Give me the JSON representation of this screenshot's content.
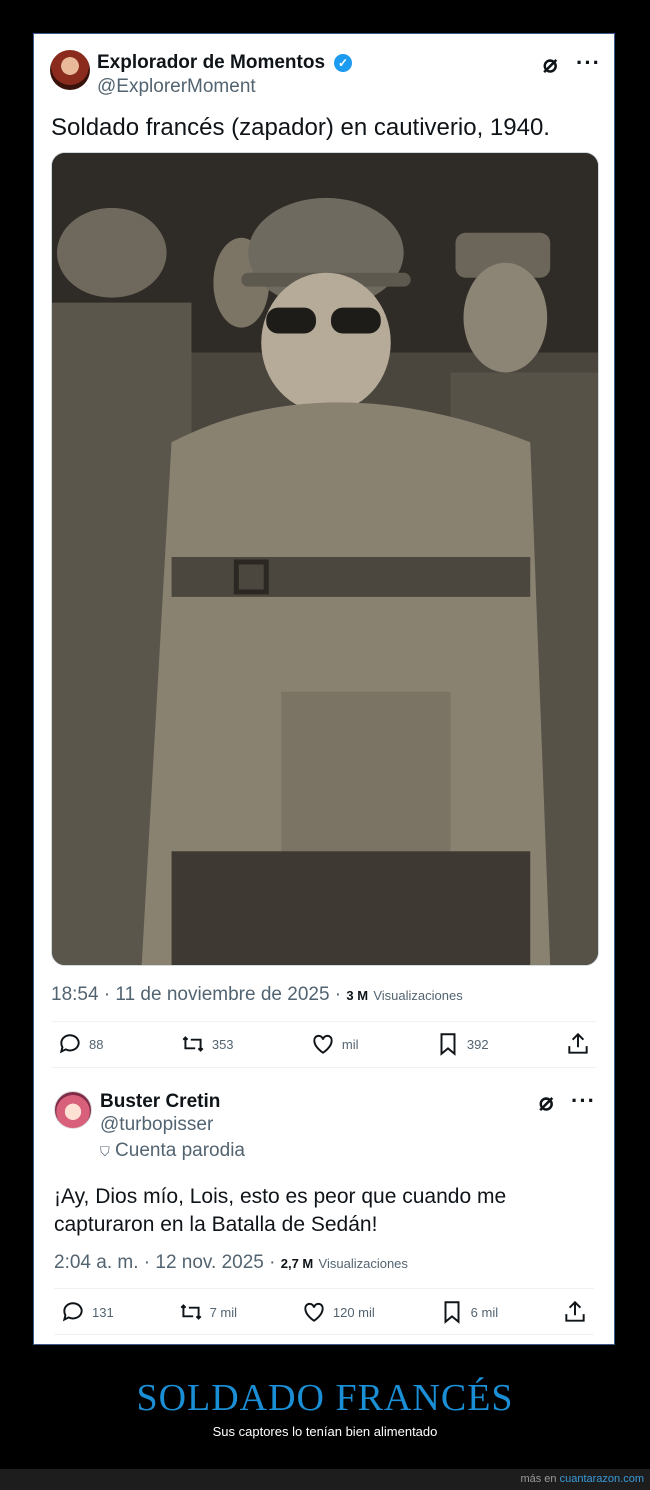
{
  "tweet1": {
    "display_name": "Explorador de Momentos",
    "handle": "@ExplorerMoment",
    "text": "Soldado francés (zapador) en cautiverio, 1940.",
    "time": "18:54 · 11 de noviembre de 2025 ·",
    "views_count": "3 M",
    "views_label": "Visualizaciones",
    "replies": "88",
    "reposts": "353",
    "likes": "mil",
    "bookmarks": "392",
    "icons": [
      "verified-badge-icon",
      "grok-icon",
      "more-icon",
      "reply-icon",
      "repost-icon",
      "like-icon",
      "bookmark-icon",
      "share-icon"
    ]
  },
  "tweet2": {
    "display_name": "Buster Cretin",
    "handle": "@turbopisser",
    "parody_label": "Cuenta parodia",
    "text": "¡Ay, Dios mío, Lois, esto es peor que cuando me capturaron en la Batalla de Sedán!",
    "time": "2:04 a. m. · 12 nov. 2025 ·",
    "views_count": "2,7 M",
    "views_label": "Visualizaciones",
    "replies": "131",
    "reposts": "7 mil",
    "likes": "120 mil",
    "bookmarks": "6 mil"
  },
  "caption": {
    "title": "SOLDADO FRANCÉS",
    "subtitle": "Sus captores lo tenían bien alimentado"
  },
  "footer": {
    "prefix": "más en",
    "site": "cuantarazon.com"
  },
  "colors": {
    "accent": "#1d9bf0",
    "caption_title": "#1a8fd6",
    "muted": "#536471"
  }
}
